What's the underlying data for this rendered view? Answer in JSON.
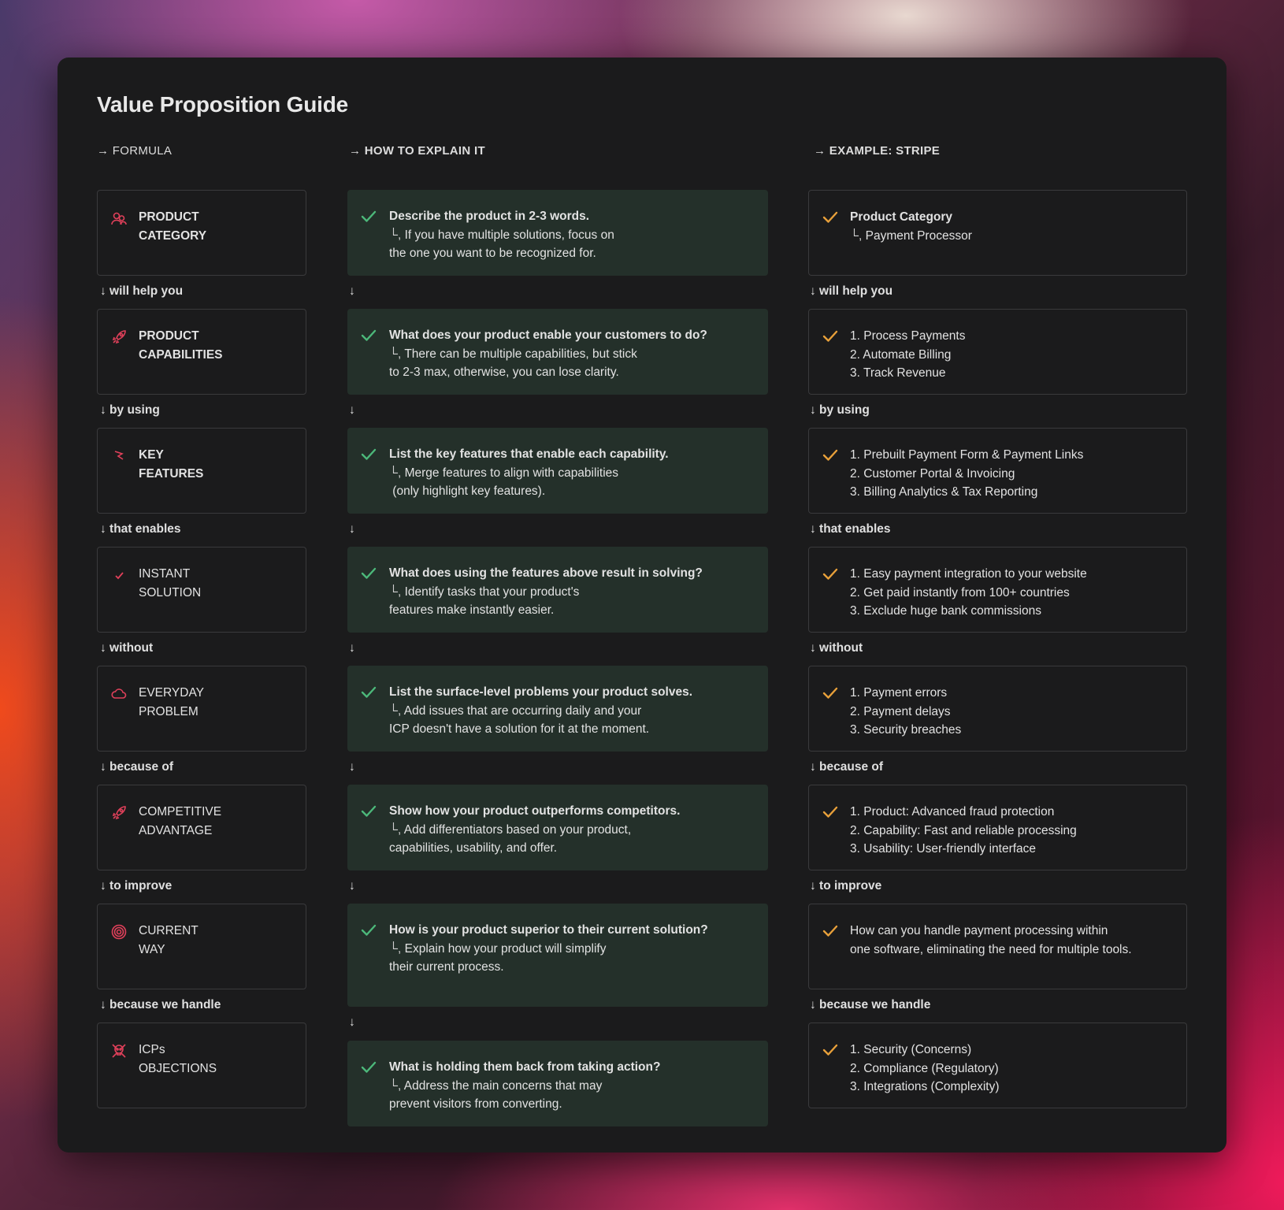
{
  "title": "Value Proposition Guide",
  "columns": {
    "formula": "→ FORMULA",
    "how": "→ HOW TO EXPLAIN IT",
    "example": "→ EXAMPLE: STRIPE"
  },
  "arrow": "↓",
  "sub_prefix": "└,",
  "rows": [
    {
      "formula": [
        "PRODUCT",
        "CATEGORY"
      ],
      "formula_icon": "users-icon",
      "how_q": "Describe the product in 2-3 words.",
      "how_l1": "If you have multiple solutions, focus on",
      "how_l2": "the one you want to be recognized for.",
      "ex_title": "Product Category",
      "ex_lines": [
        "Payment Processor"
      ],
      "connector": "↓ will help you"
    },
    {
      "formula": [
        "PRODUCT",
        "CAPABILITIES"
      ],
      "formula_icon": "rocket-icon",
      "how_q": "What does your product enable your customers to do?",
      "how_l1": "There can be multiple capabilities, but stick",
      "how_l2": "to 2-3 max, otherwise, you can lose clarity.",
      "ex_lines": [
        "1. Process Payments",
        "2. Automate Billing",
        "3. Track Revenue"
      ],
      "connector": "↓ by using"
    },
    {
      "formula": [
        "KEY",
        "FEATURES"
      ],
      "formula_icon": "lightning-icon",
      "how_q": "List the key features that enable each capability.",
      "how_l1": "Merge features to align with capabilities",
      "how_l2": " (only highlight key features).",
      "ex_lines": [
        "1. Prebuilt Payment Form & Payment Links",
        "2. Customer Portal & Invoicing",
        "3. Billing Analytics & Tax Reporting"
      ],
      "connector": "↓ that enables"
    },
    {
      "formula": [
        "INSTANT",
        "SOLUTION"
      ],
      "formula_icon": "check-icon",
      "how_q": "What does using the features above result in solving?",
      "how_l1": "Identify tasks that your product's",
      "how_l2": "features make instantly easier.",
      "ex_lines": [
        "1. Easy payment integration to your website",
        "2. Get paid instantly from 100+ countries",
        "3. Exclude huge bank commissions"
      ],
      "connector": "↓ without"
    },
    {
      "formula": [
        "EVERYDAY",
        "PROBLEM"
      ],
      "formula_icon": "cloud-icon",
      "how_q": "List the surface-level problems your product solves.",
      "how_l1": "Add issues that are occurring daily and your",
      "how_l2": "ICP doesn't have a solution for it at the moment.",
      "ex_lines": [
        "1. Payment errors",
        "2. Payment delays",
        "3. Security breaches"
      ],
      "connector": "↓ because of"
    },
    {
      "formula": [
        "COMPETITIVE",
        "ADVANTAGE"
      ],
      "formula_icon": "rocket-icon",
      "how_q": "Show how your product outperforms competitors.",
      "how_l1": "Add differentiators based on your product,",
      "how_l2": "capabilities, usability, and offer.",
      "ex_lines": [
        "1. Product: Advanced fraud protection",
        "2. Capability: Fast and reliable processing",
        "3. Usability: User-friendly interface"
      ],
      "connector": "↓ to improve"
    },
    {
      "formula": [
        "CURRENT",
        "WAY"
      ],
      "formula_icon": "target-icon",
      "how_q": "How is your product superior to their current solution?",
      "how_l1": "Explain how your product will simplify",
      "how_l2": "their current process.",
      "ex_lines": [
        "How can you handle payment processing within",
        "one software, eliminating the need for multiple tools."
      ],
      "connector": "↓ because we handle"
    },
    {
      "formula": [
        "ICPs",
        "OBJECTIONS"
      ],
      "formula_icon": "skull-icon",
      "how_q": "What is holding them back from taking action?",
      "how_l1": "Address the main concerns that may",
      "how_l2": "prevent visitors from converting.",
      "ex_lines": [
        "1. Security (Concerns)",
        "2. Compliance (Regulatory)",
        "3. Integrations (Complexity)"
      ]
    }
  ],
  "colors": {
    "panel": "#1b1b1c",
    "how_box": "#24302a",
    "green_check": "#4cb87a",
    "orange_check": "#e8a03a",
    "red_icon": "#e0405a"
  }
}
